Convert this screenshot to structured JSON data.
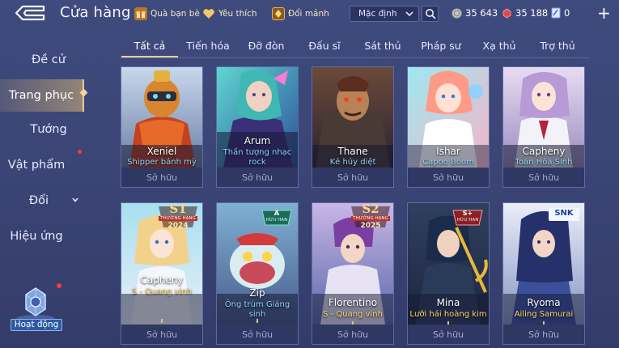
{
  "header": {
    "title": "Cửa hàng",
    "friend_gift_label": "Quà bạn bè",
    "favorites_label": "Yêu thích",
    "exchange_label": "Đổi mảnh",
    "sort_value": "Mặc định",
    "gold_amount": "35 643",
    "ruby_amount": "35 188",
    "voucher_amount": "0",
    "plus_label": "+"
  },
  "sidebar": {
    "items": [
      {
        "label": "Đề cử"
      },
      {
        "label": "Trang phục"
      },
      {
        "label": "Tướng"
      },
      {
        "label": "Vật phẩm"
      },
      {
        "label": "Đổi"
      },
      {
        "label": "Hiệu ứng"
      }
    ],
    "activity_label": "Hoạt động"
  },
  "tabs": [
    "Tất cả",
    "Tiến hóa",
    "Đỡ đòn",
    "Đấu sĩ",
    "Sát thủ",
    "Pháp sư",
    "Xạ thủ",
    "Trợ thủ"
  ],
  "cards": [
    {
      "hero": "Xeniel",
      "skin": "Shipper bánh mỳ",
      "status": "Sở hữu"
    },
    {
      "hero": "Arum",
      "skin": "Thần tượng nhạc rock",
      "status": "Sở hữu"
    },
    {
      "hero": "Thane",
      "skin": "Kẻ hủy diệt",
      "status": "Sở hữu"
    },
    {
      "hero": "Ishar",
      "skin": "Capoo Boom",
      "status": "Sở hữu"
    },
    {
      "hero": "Capheny",
      "skin": "Toán Hóa Sinh",
      "status": "Sở hữu"
    },
    {
      "hero": "Capheny",
      "skin": "S - Quang vinh",
      "status": "Sở hữu",
      "badge": {
        "top": "S1",
        "mid": "THƯỜNG HẠNG",
        "bottom": "2024"
      }
    },
    {
      "hero": "Zip",
      "skin": "Ông trùm Giáng sinh",
      "status": "Sở hữu",
      "badge": {
        "top": "A",
        "mid": "HỮU HẠN"
      }
    },
    {
      "hero": "Florentino",
      "skin": "S - Quang vinh",
      "status": "Sở hữu",
      "badge": {
        "top": "S2",
        "mid": "THƯỜNG HẠNG",
        "bottom": "2025"
      }
    },
    {
      "hero": "Mina",
      "skin": "Lưỡi hái hoàng kim",
      "status": "Sở hữu",
      "badge": {
        "top": "S+",
        "mid": "HỮU HẠN"
      }
    },
    {
      "hero": "Ryoma",
      "skin": "Ailing Samurai",
      "status": "Sở hữu",
      "badge": {
        "top": "SNK"
      }
    }
  ],
  "colors": {
    "background": "#3a4474",
    "accent_gold": "#e8cf95",
    "skin_name_blue": "#8fd4ff",
    "skin_name_gold": "#ffd86a",
    "notification_red": "#ff3b3b"
  },
  "icons": {
    "back": "back-arrow-icon",
    "friend_gift": "gift-icon",
    "favorites": "heart-icon",
    "exchange": "shard-exchange-icon",
    "search": "search-icon",
    "gold": "gold-coin-icon",
    "ruby": "ruby-icon",
    "voucher": "voucher-icon"
  }
}
